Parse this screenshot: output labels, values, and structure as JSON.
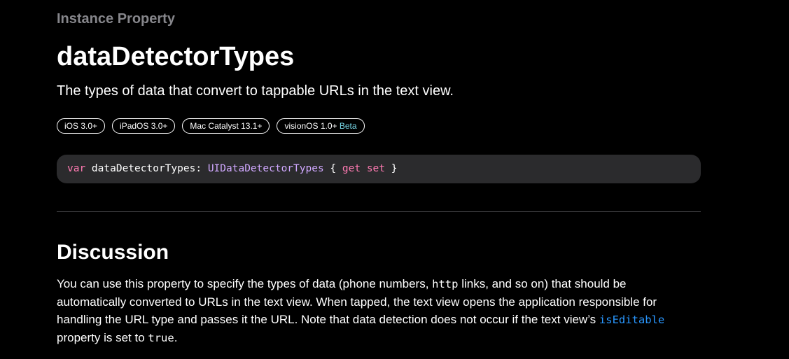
{
  "header": {
    "eyebrow": "Instance Property",
    "title": "dataDetectorTypes",
    "abstract": "The types of data that convert to tappable URLs in the text view."
  },
  "availability": [
    {
      "label": "iOS 3.0+"
    },
    {
      "label": "iPadOS 3.0+"
    },
    {
      "label": "Mac Catalyst 13.1+"
    },
    {
      "label": "visionOS 1.0+",
      "beta": "Beta"
    }
  ],
  "declaration": {
    "keyword": "var",
    "name": " dataDetectorTypes: ",
    "type": "UIDataDetectorTypes",
    "open_brace": " { ",
    "get": "get",
    "space": " ",
    "set": "set",
    "close_brace": " }"
  },
  "discussion": {
    "heading": "Discussion",
    "text_1": "You can use this property to specify the types of data (phone numbers, ",
    "code_http": "http",
    "text_2": " links, and so on) that should be automatically converted to URLs in the text view. When tapped, the text view opens the application responsible for handling the URL type and passes it the URL. Note that data detection does not occur if the text view’s ",
    "link_iseditable": "isEditable",
    "text_3": " property is set to ",
    "code_true": "true",
    "text_4": "."
  },
  "colors": {
    "background": "#000000",
    "eyebrow": "#86868b",
    "keyword": "#ff7ab2",
    "type": "#d0a8ff",
    "link": "#2997ff",
    "beta": "#76d6e6",
    "code_background": "#2b2b2d"
  }
}
